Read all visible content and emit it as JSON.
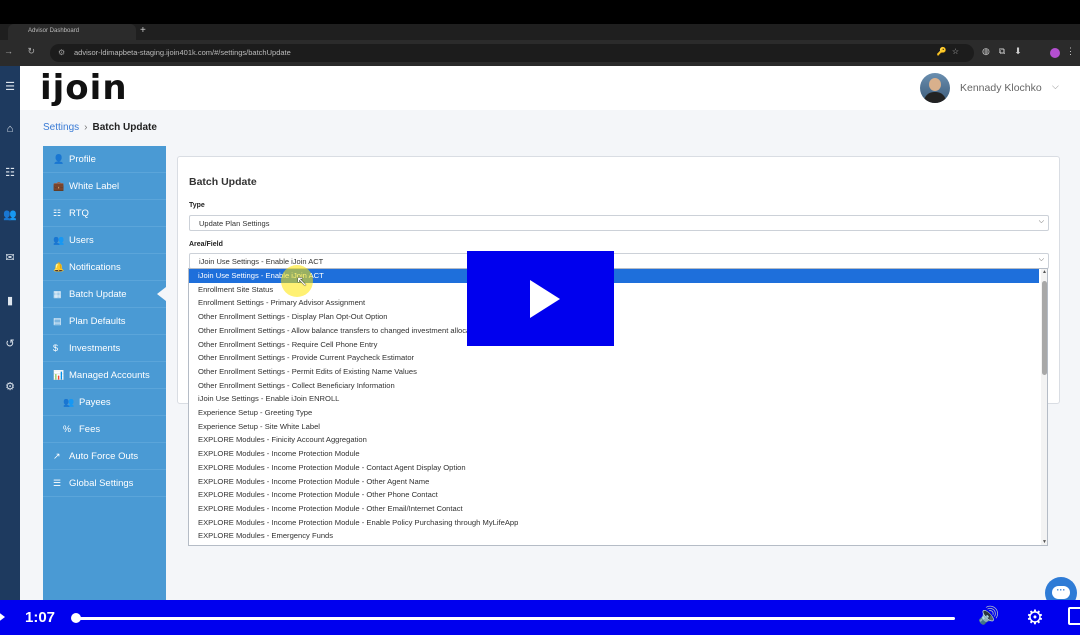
{
  "browser": {
    "tab_title": "Advisor Dashboard",
    "url": "advisor-ldimapbeta-staging.ijoin401k.com/#/settings/batchUpdate"
  },
  "header": {
    "logo": "ijoin",
    "user_name": "Kennady Klochko"
  },
  "breadcrumb": {
    "parent": "Settings",
    "separator": "›",
    "current": "Batch Update"
  },
  "sidebar": {
    "items": [
      {
        "label": "Profile",
        "icon": "user-icon",
        "glyph": "👤"
      },
      {
        "label": "White Label",
        "icon": "briefcase-icon",
        "glyph": "💼"
      },
      {
        "label": "RTQ",
        "icon": "list-icon",
        "glyph": "☷"
      },
      {
        "label": "Users",
        "icon": "users-icon",
        "glyph": "👥"
      },
      {
        "label": "Notifications",
        "icon": "bell-icon",
        "glyph": "🔔"
      },
      {
        "label": "Batch Update",
        "icon": "grid-icon",
        "glyph": "▦"
      },
      {
        "label": "Plan Defaults",
        "icon": "table-icon",
        "glyph": "▤"
      },
      {
        "label": "Investments",
        "icon": "dollar-icon",
        "glyph": "$"
      },
      {
        "label": "Managed Accounts",
        "icon": "chart-icon",
        "glyph": "📊"
      },
      {
        "label": "Payees",
        "icon": "payees-icon",
        "glyph": "👥"
      },
      {
        "label": "Fees",
        "icon": "percent-icon",
        "glyph": "%"
      },
      {
        "label": "Auto Force Outs",
        "icon": "external-link-icon",
        "glyph": "↗"
      },
      {
        "label": "Global Settings",
        "icon": "sliders-icon",
        "glyph": "☰"
      }
    ]
  },
  "form": {
    "title": "Batch Update",
    "type_label": "Type",
    "type_value": "Update Plan Settings",
    "area_label": "Area/Field",
    "area_value": "iJoin Use Settings - Enable iJoin ACT"
  },
  "dropdown": {
    "options": [
      "iJoin Use Settings - Enable iJoin ACT",
      "Enrollment Site Status",
      "Enrollment Settings - Primary Advisor Assignment",
      "Other Enrollment Settings - Display Plan Opt-Out Option",
      "Other Enrollment Settings - Allow balance transfers to changed investment allocation",
      "Other Enrollment Settings - Require Cell Phone Entry",
      "Other Enrollment Settings - Provide Current Paycheck Estimator",
      "Other Enrollment Settings - Permit Edits of Existing Name Values",
      "Other Enrollment Settings - Collect Beneficiary Information",
      "iJoin Use Settings - Enable iJoin ENROLL",
      "Experience Setup - Greeting Type",
      "Experience Setup - Site White Label",
      "EXPLORE Modules - Finicity Account Aggregation",
      "EXPLORE Modules - Income Protection Module",
      "EXPLORE Modules - Income Protection Module - Contact Agent Display Option",
      "EXPLORE Modules - Income Protection Module - Other Agent Name",
      "EXPLORE Modules - Income Protection Module - Other Phone Contact",
      "EXPLORE Modules - Income Protection Module - Other Email/Internet Contact",
      "EXPLORE Modules - Income Protection Module - Enable Policy Purchasing through MyLifeApp",
      "EXPLORE Modules - Emergency Funds"
    ],
    "selected_index": 0
  },
  "video": {
    "time": "1:07",
    "progress_fraction": 0.0
  },
  "colors": {
    "sidebar_bg": "#4a9ad4",
    "selected_option": "#1e6fdb",
    "video_overlay": "#0000ee",
    "cursor_highlight": "#ffe600"
  }
}
